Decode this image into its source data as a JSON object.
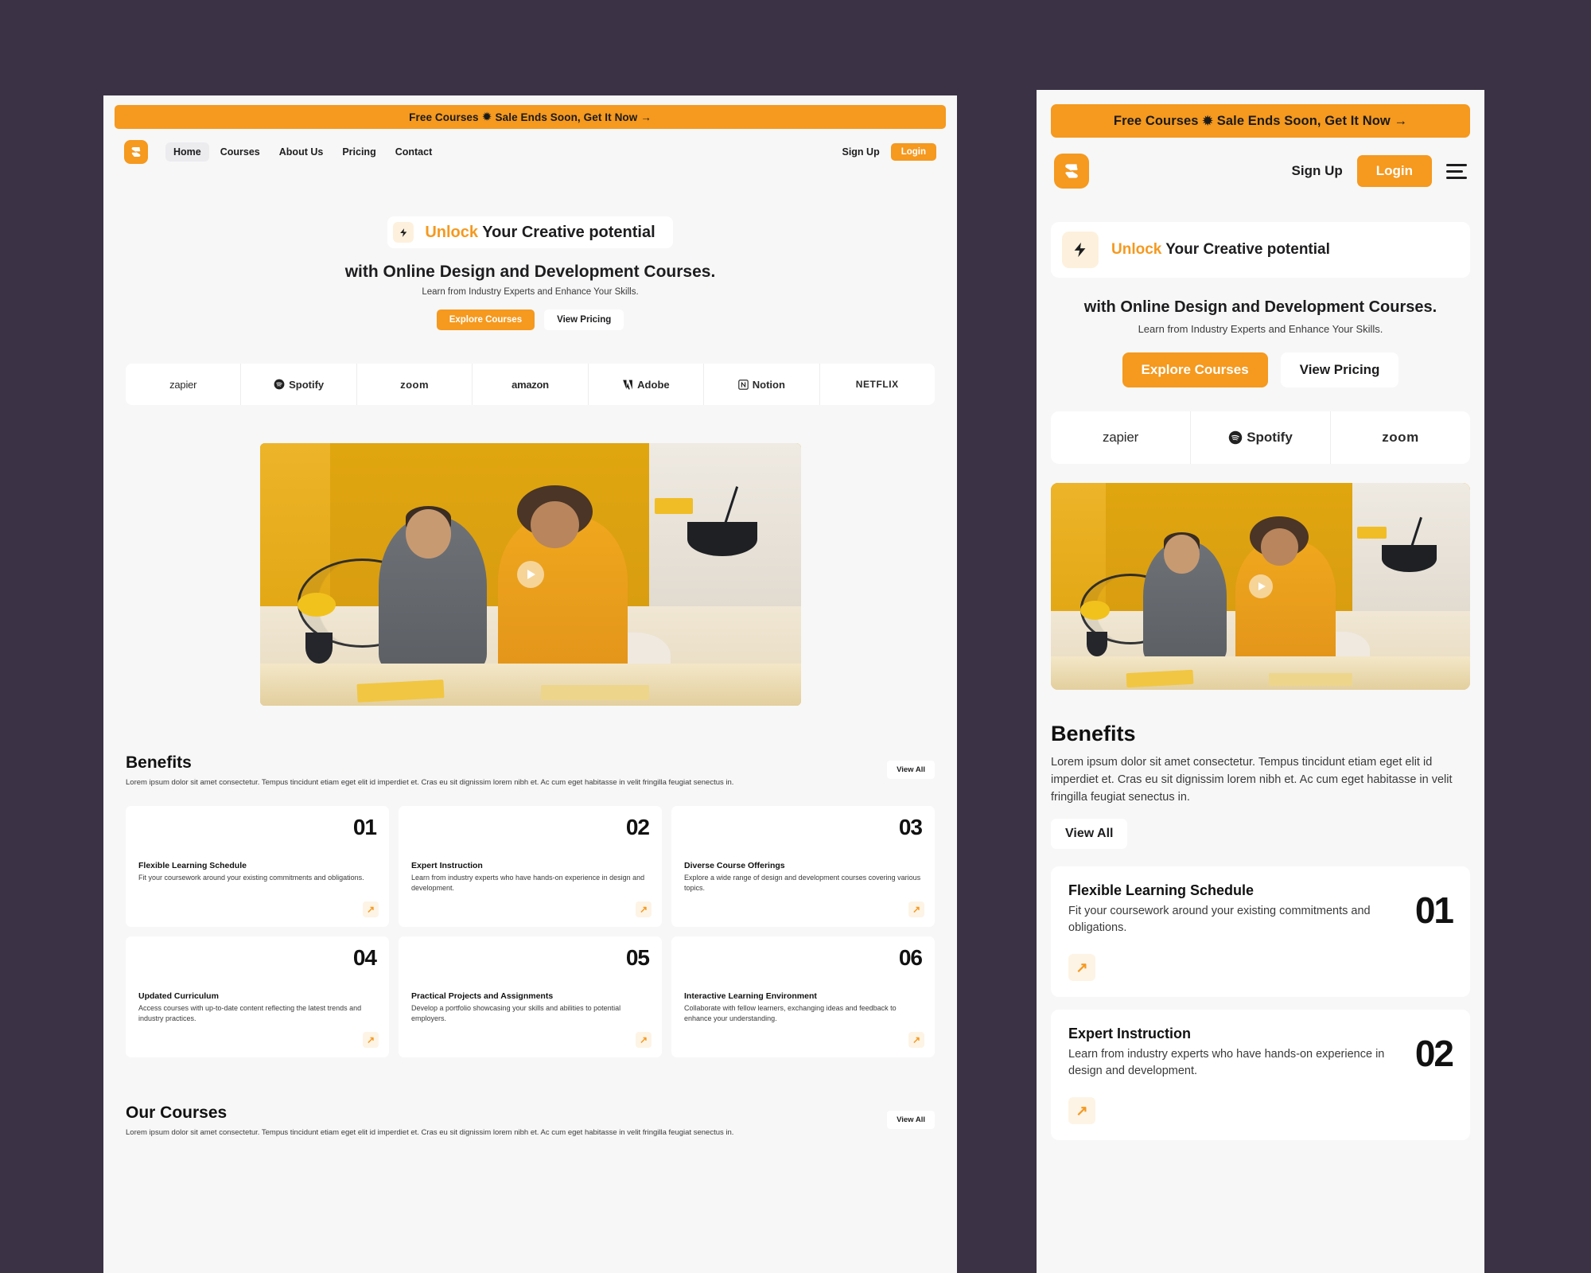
{
  "promo": {
    "text_before": "Free Courses",
    "sparkle_icon": "✹",
    "text_after": "Sale Ends Soon, Get It Now →"
  },
  "brand": {
    "name": "S"
  },
  "nav": {
    "links": [
      {
        "label": "Home",
        "active": true
      },
      {
        "label": "Courses",
        "active": false
      },
      {
        "label": "About Us",
        "active": false
      },
      {
        "label": "Pricing",
        "active": false
      },
      {
        "label": "Contact",
        "active": false
      }
    ],
    "signup_label": "Sign Up",
    "login_label": "Login",
    "menu_icon": "hamburger-icon"
  },
  "hero": {
    "bolt_icon": "⚡",
    "eyebrow_highlight": "Unlock",
    "eyebrow_rest": " Your Creative potential",
    "headline": "with Online Design and Development Courses.",
    "subhead": "Learn from Industry Experts and Enhance Your Skills.",
    "cta_primary": "Explore Courses",
    "cta_secondary": "View Pricing"
  },
  "logos": {
    "desktop": [
      "zapier",
      "Spotify",
      "zoom",
      "amazon",
      "Adobe",
      "Notion",
      "NETFLIX"
    ],
    "mobile": [
      "zapier",
      "Spotify",
      "zoom"
    ]
  },
  "video": {
    "play_icon": "play-icon"
  },
  "benefits": {
    "title": "Benefits",
    "description": "Lorem ipsum dolor sit amet consectetur. Tempus tincidunt etiam eget elit id imperdiet et. Cras eu sit dignissim lorem nibh et. Ac cum eget habitasse in velit fringilla feugiat senectus in.",
    "view_all": "View All",
    "items": [
      {
        "num": "01",
        "title": "Flexible Learning Schedule",
        "desc": "Fit your coursework around your existing commitments and obligations."
      },
      {
        "num": "02",
        "title": "Expert Instruction",
        "desc": "Learn from industry experts who have hands-on experience in design and development."
      },
      {
        "num": "03",
        "title": "Diverse Course Offerings",
        "desc": "Explore a wide range of design and development courses covering various topics."
      },
      {
        "num": "04",
        "title": "Updated Curriculum",
        "desc": "Access courses with up-to-date content reflecting the latest trends and industry practices."
      },
      {
        "num": "05",
        "title": "Practical Projects and Assignments",
        "desc": "Develop a portfolio showcasing your skills and abilities to potential employers."
      },
      {
        "num": "06",
        "title": "Interactive Learning Environment",
        "desc": "Collaborate with fellow learners, exchanging ideas and feedback to enhance your understanding."
      }
    ],
    "arrow_icon": "↗"
  },
  "courses": {
    "title": "Our Courses",
    "description": "Lorem ipsum dolor sit amet consectetur. Tempus tincidunt etiam eget elit id imperdiet et. Cras eu sit dignissim lorem nibh et. Ac cum eget habitasse in velit fringilla feugiat senectus in.",
    "view_all": "View All"
  },
  "colors": {
    "accent": "#f5991f",
    "page_background": "#3b3245",
    "panel_background": "#f7f7f7",
    "card_background": "#ffffff",
    "text_dark": "#111111"
  }
}
